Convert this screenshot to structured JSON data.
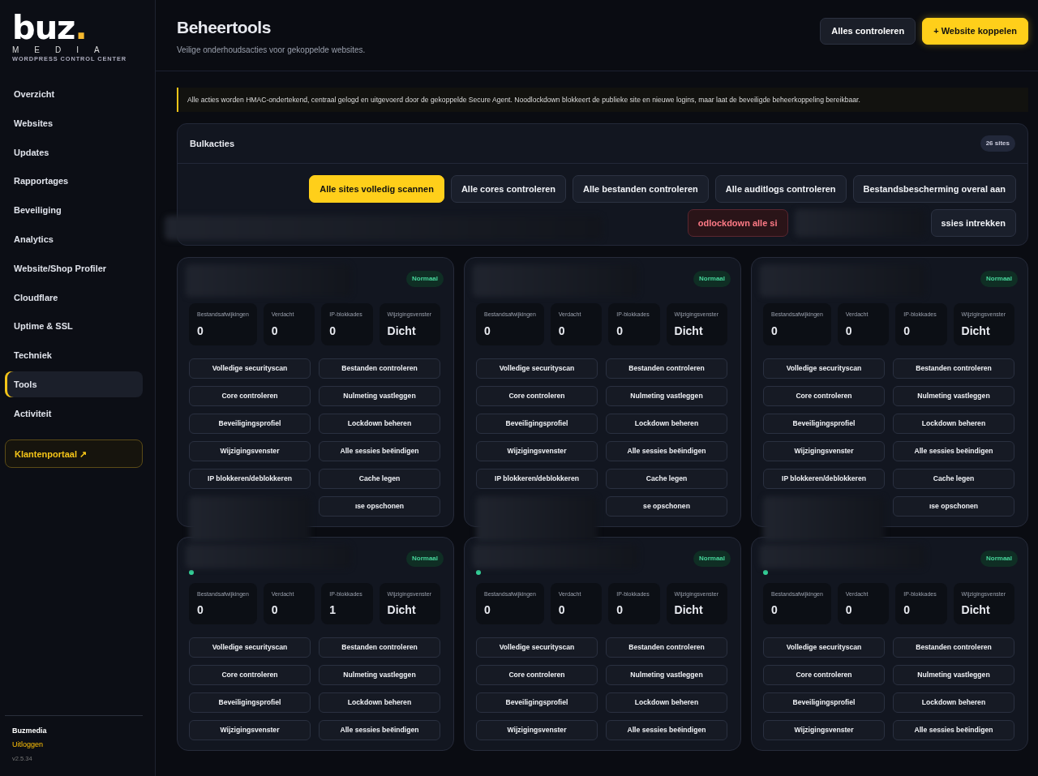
{
  "brand": {
    "logo": "buz",
    "logo_dot": ".",
    "sub": "MEDIA",
    "tagline": "WORDPRESS CONTROL CENTER"
  },
  "sidebar": {
    "items": [
      {
        "label": "Overzicht",
        "selected": false
      },
      {
        "label": "Websites",
        "selected": false
      },
      {
        "label": "Updates",
        "selected": false
      },
      {
        "label": "Rapportages",
        "selected": false
      },
      {
        "label": "Beveiliging",
        "selected": false
      },
      {
        "label": "Analytics",
        "selected": false
      },
      {
        "label": "Website/Shop Profiler",
        "selected": false
      },
      {
        "label": "Cloudflare",
        "selected": false
      },
      {
        "label": "Uptime & SSL",
        "selected": false
      },
      {
        "label": "Techniek",
        "selected": false
      },
      {
        "label": "Tools",
        "selected": true
      },
      {
        "label": "Activiteit",
        "selected": false
      }
    ],
    "portal": "Klantenportaal ↗",
    "user": "Buzmedia",
    "logout": "Uitloggen",
    "version": "v2.5.34"
  },
  "header": {
    "title": "Beheertools",
    "subtitle": "Veilige onderhoudsacties voor gekoppelde websites.",
    "buttons": [
      {
        "label": "Alles controleren",
        "kind": "secondary"
      },
      {
        "label": "+ Website koppelen",
        "kind": "primary"
      }
    ]
  },
  "notice": "Alle acties worden HMAC-ondertekend, centraal gelogd en uitgevoerd door de gekoppelde Secure Agent. Noodlockdown blokkeert de publieke site en nieuwe logins, maar laat de beveiligde beheerkoppeling bereikbaar.",
  "bulk": {
    "title": "Bulkacties",
    "count": "26 sites",
    "actions": [
      {
        "label": "Alle sites volledig scannen",
        "kind": "primary"
      },
      {
        "label": "Alle cores controleren",
        "kind": "secondary"
      },
      {
        "label": "Alle bestanden controleren",
        "kind": "secondary"
      },
      {
        "label": "Alle auditlogs controleren",
        "kind": "secondary"
      },
      {
        "label": "Bestandsbescherming overal aan",
        "kind": "secondary"
      },
      {
        "label": "odlockdown alle si",
        "kind": "danger"
      },
      {
        "kind": "redacted"
      },
      {
        "label": "ssies intrekken",
        "kind": "secondary"
      }
    ]
  },
  "sites": [
    {
      "status": "Normaal",
      "stats": [
        {
          "label": "Bestandsafwijkingen",
          "value": "0"
        },
        {
          "label": "Verdacht",
          "value": "0"
        },
        {
          "label": "IP-blokkades",
          "value": "0"
        },
        {
          "label": "Wijzigingsvenster",
          "value": "Dicht"
        }
      ],
      "actions": [
        {
          "label": "Volledige securityscan"
        },
        {
          "label": "Bestanden controleren"
        },
        {
          "label": "Core controleren"
        },
        {
          "label": "Nulmeting vastleggen"
        },
        {
          "label": "Beveiligingsprofiel"
        },
        {
          "label": "Lockdown beheren"
        },
        {
          "label": "Wijzigingsvenster"
        },
        {
          "label": "Alle sessies beëindigen"
        },
        {
          "label": "IP blokkeren/deblokkeren"
        },
        {
          "label": "Cache legen"
        },
        {
          "kind": "redacted"
        },
        {
          "label": "ıse opschonen"
        }
      ]
    },
    {
      "status": "Normaal",
      "stats": [
        {
          "label": "Bestandsafwijkingen",
          "value": "0"
        },
        {
          "label": "Verdacht",
          "value": "0"
        },
        {
          "label": "IP-blokkades",
          "value": "0"
        },
        {
          "label": "Wijzigingsvenster",
          "value": "Dicht"
        }
      ],
      "actions": [
        {
          "label": "Volledige securityscan"
        },
        {
          "label": "Bestanden controleren"
        },
        {
          "label": "Core controleren"
        },
        {
          "label": "Nulmeting vastleggen"
        },
        {
          "label": "Beveiligingsprofiel"
        },
        {
          "label": "Lockdown beheren"
        },
        {
          "label": "Wijzigingsvenster"
        },
        {
          "label": "Alle sessies beëindigen"
        },
        {
          "label": "IP blokkeren/deblokkeren"
        },
        {
          "label": "Cache legen"
        },
        {
          "kind": "redacted"
        },
        {
          "label": "se opschonen"
        }
      ]
    },
    {
      "status": "Normaal",
      "stats": [
        {
          "label": "Bestandsafwijkingen",
          "value": "0"
        },
        {
          "label": "Verdacht",
          "value": "0"
        },
        {
          "label": "IP-blokkades",
          "value": "0"
        },
        {
          "label": "Wijzigingsvenster",
          "value": "Dicht"
        }
      ],
      "actions": [
        {
          "label": "Volledige securityscan"
        },
        {
          "label": "Bestanden controleren"
        },
        {
          "label": "Core controleren"
        },
        {
          "label": "Nulmeting vastleggen"
        },
        {
          "label": "Beveiligingsprofiel"
        },
        {
          "label": "Lockdown beheren"
        },
        {
          "label": "Wijzigingsvenster"
        },
        {
          "label": "Alle sessies beëindigen"
        },
        {
          "label": "IP blokkeren/deblokkeren"
        },
        {
          "label": "Cache legen"
        },
        {
          "kind": "redacted"
        },
        {
          "label": "ıse opschonen"
        }
      ]
    },
    {
      "status": "Normaal",
      "online": true,
      "stats": [
        {
          "label": "Bestandsafwijkingen",
          "value": "0"
        },
        {
          "label": "Verdacht",
          "value": "0"
        },
        {
          "label": "IP-blokkades",
          "value": "1"
        },
        {
          "label": "Wijzigingsvenster",
          "value": "Dicht"
        }
      ],
      "actions": [
        {
          "label": "Volledige securityscan"
        },
        {
          "label": "Bestanden controleren"
        },
        {
          "label": "Core controleren"
        },
        {
          "label": "Nulmeting vastleggen"
        },
        {
          "label": "Beveiligingsprofiel"
        },
        {
          "label": "Lockdown beheren"
        },
        {
          "label": "Wijzigingsvenster"
        },
        {
          "label": "Alle sessies beëindigen"
        }
      ]
    },
    {
      "status": "Normaal",
      "online": true,
      "stats": [
        {
          "label": "Bestandsafwijkingen",
          "value": "0"
        },
        {
          "label": "Verdacht",
          "value": "0"
        },
        {
          "label": "IP-blokkades",
          "value": "0"
        },
        {
          "label": "Wijzigingsvenster",
          "value": "Dicht"
        }
      ],
      "actions": [
        {
          "label": "Volledige securityscan"
        },
        {
          "label": "Bestanden controleren"
        },
        {
          "label": "Core controleren"
        },
        {
          "label": "Nulmeting vastleggen"
        },
        {
          "label": "Beveiligingsprofiel"
        },
        {
          "label": "Lockdown beheren"
        },
        {
          "label": "Wijzigingsvenster"
        },
        {
          "label": "Alle sessies beëindigen"
        }
      ]
    },
    {
      "status": "Normaal",
      "online": true,
      "stats": [
        {
          "label": "Bestandsafwijkingen",
          "value": "0"
        },
        {
          "label": "Verdacht",
          "value": "0"
        },
        {
          "label": "IP-blokkades",
          "value": "0"
        },
        {
          "label": "Wijzigingsvenster",
          "value": "Dicht"
        }
      ],
      "actions": [
        {
          "label": "Volledige securityscan"
        },
        {
          "label": "Bestanden controleren"
        },
        {
          "label": "Core controleren"
        },
        {
          "label": "Nulmeting vastleggen"
        },
        {
          "label": "Beveiligingsprofiel"
        },
        {
          "label": "Lockdown beheren"
        },
        {
          "label": "Wijzigingsvenster"
        },
        {
          "label": "Alle sessies beëindigen"
        }
      ]
    }
  ]
}
